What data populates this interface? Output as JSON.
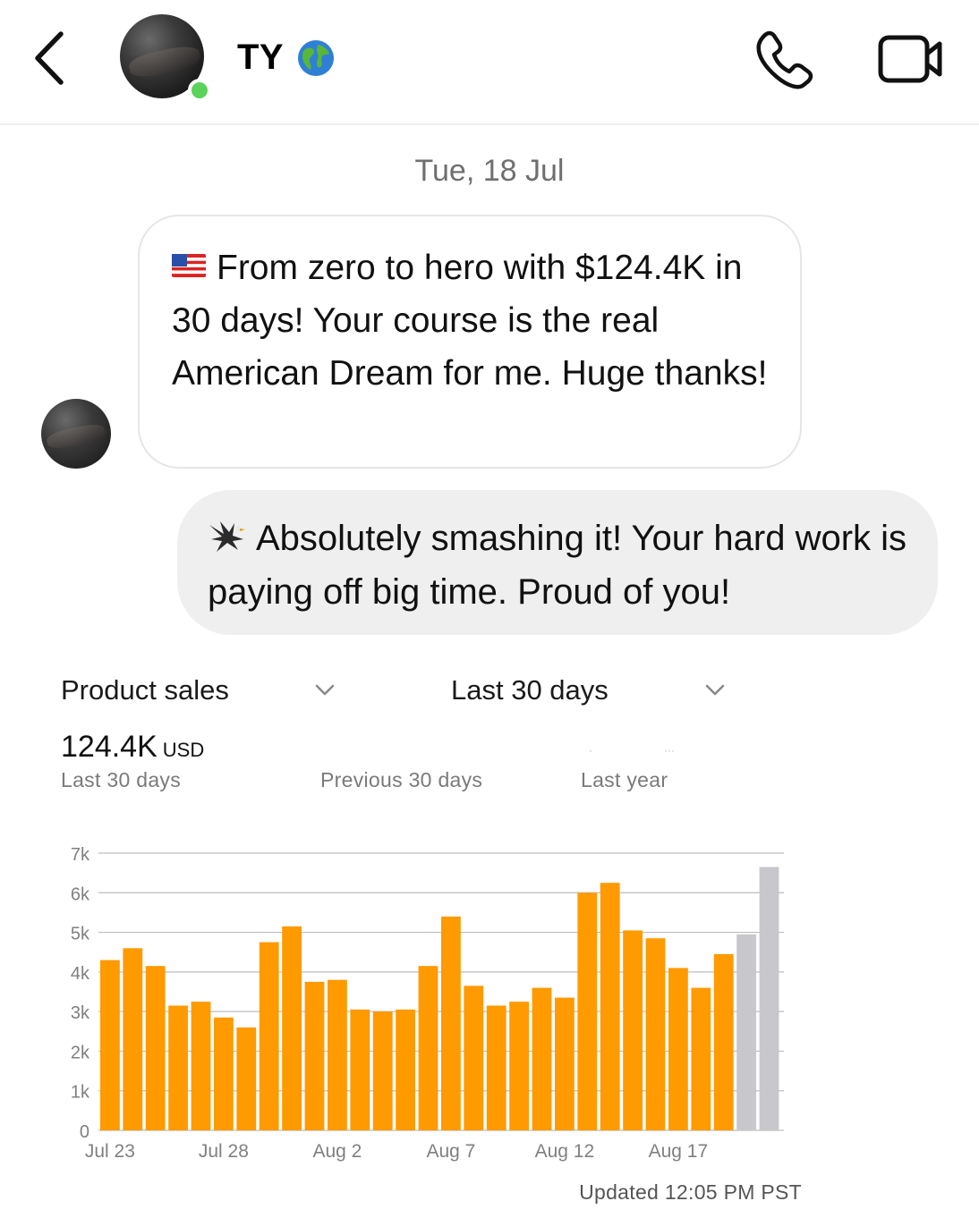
{
  "header": {
    "contact_name": "TY",
    "online": true,
    "icons": [
      "back-icon",
      "avatar",
      "globe-icon",
      "phone-icon",
      "video-camera-icon"
    ]
  },
  "conversation": {
    "date": "Tue, 18 Jul",
    "incoming_message": "From zero to hero with $124.4K in 30 days! Your course is the real American Dream for me. Huge thanks!",
    "incoming_emoji": "us-flag-icon",
    "outgoing_message": "Absolutely smashing it! Your hard work is paying off big time. Proud of you!",
    "outgoing_emoji": "eagle-icon"
  },
  "dashboard": {
    "metric_select": "Product sales",
    "range_select": "Last 30 days",
    "total_value": "124.4K",
    "total_unit": "USD",
    "period_current": "Last 30 days",
    "period_previous": "Previous 30 days",
    "period_last_year": "Last year",
    "updated": "Updated 12:05 PM PST"
  },
  "chart_data": {
    "type": "bar",
    "categories": [
      "Jul 23",
      "Jul 24",
      "Jul 25",
      "Jul 26",
      "Jul 27",
      "Jul 28",
      "Jul 29",
      "Jul 30",
      "Jul 31",
      "Aug 1",
      "Aug 2",
      "Aug 3",
      "Aug 4",
      "Aug 5",
      "Aug 6",
      "Aug 7",
      "Aug 8",
      "Aug 9",
      "Aug 10",
      "Aug 11",
      "Aug 12",
      "Aug 13",
      "Aug 14",
      "Aug 15",
      "Aug 16",
      "Aug 17",
      "Aug 18",
      "Aug 19",
      "Aug 20",
      "Aug 21"
    ],
    "x_tick_labels": [
      "Jul 23",
      "Jul 28",
      "Aug 2",
      "Aug 7",
      "Aug 12",
      "Aug 17"
    ],
    "series": [
      {
        "values": [
          4300,
          4600,
          4150,
          3150,
          3250,
          2850,
          2600,
          4750,
          5150,
          3750,
          3800,
          3050,
          3000,
          3050,
          4150,
          5400,
          3650,
          3150,
          3250,
          3600,
          3350,
          6000,
          6250,
          5050,
          4850,
          4100,
          3600,
          4450,
          4950,
          6650
        ],
        "colors": [
          "#ff9a00",
          "#ff9a00",
          "#ff9a00",
          "#ff9a00",
          "#ff9a00",
          "#ff9a00",
          "#ff9a00",
          "#ff9a00",
          "#ff9a00",
          "#ff9a00",
          "#ff9a00",
          "#ff9a00",
          "#ff9a00",
          "#ff9a00",
          "#ff9a00",
          "#ff9a00",
          "#ff9a00",
          "#ff9a00",
          "#ff9a00",
          "#ff9a00",
          "#ff9a00",
          "#ff9a00",
          "#ff9a00",
          "#ff9a00",
          "#ff9a00",
          "#ff9a00",
          "#ff9a00",
          "#ff9a00",
          "#c7c7cc",
          "#c7c7cc"
        ]
      }
    ],
    "y_ticks": [
      "0",
      "1k",
      "2k",
      "3k",
      "4k",
      "5k",
      "6k",
      "7k"
    ],
    "ylim": [
      0,
      7000
    ],
    "grid": true,
    "colors": {
      "accent": "#ff9a00",
      "muted": "#c7c7cc",
      "grid": "#bdbdbd"
    }
  }
}
